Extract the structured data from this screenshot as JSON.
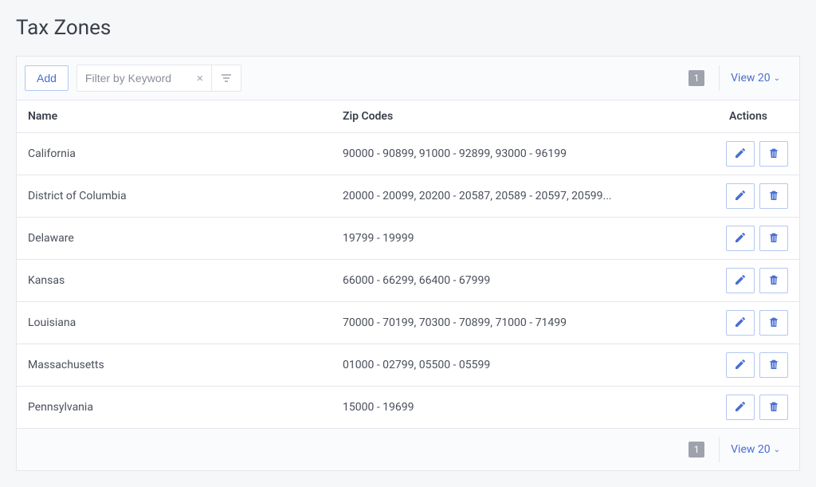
{
  "page": {
    "title": "Tax Zones"
  },
  "toolbar": {
    "add_label": "Add",
    "filter_placeholder": "Filter by Keyword",
    "page_number": "1",
    "view_label": "View 20"
  },
  "table": {
    "headers": {
      "name": "Name",
      "zip": "Zip Codes",
      "actions": "Actions"
    },
    "rows": [
      {
        "name": "California",
        "zip": "90000 - 90899, 91000 - 92899, 93000 - 96199"
      },
      {
        "name": "District of Columbia",
        "zip": "20000 - 20099, 20200 - 20587, 20589 - 20597, 20599..."
      },
      {
        "name": "Delaware",
        "zip": "19799 - 19999"
      },
      {
        "name": "Kansas",
        "zip": "66000 - 66299, 66400 - 67999"
      },
      {
        "name": "Louisiana",
        "zip": "70000 - 70199, 70300 - 70899, 71000 - 71499"
      },
      {
        "name": "Massachusetts",
        "zip": "01000 - 02799, 05500 - 05599"
      },
      {
        "name": "Pennsylvania",
        "zip": "15000 - 19699"
      }
    ]
  },
  "footer": {
    "page_number": "1",
    "view_label": "View 20"
  }
}
